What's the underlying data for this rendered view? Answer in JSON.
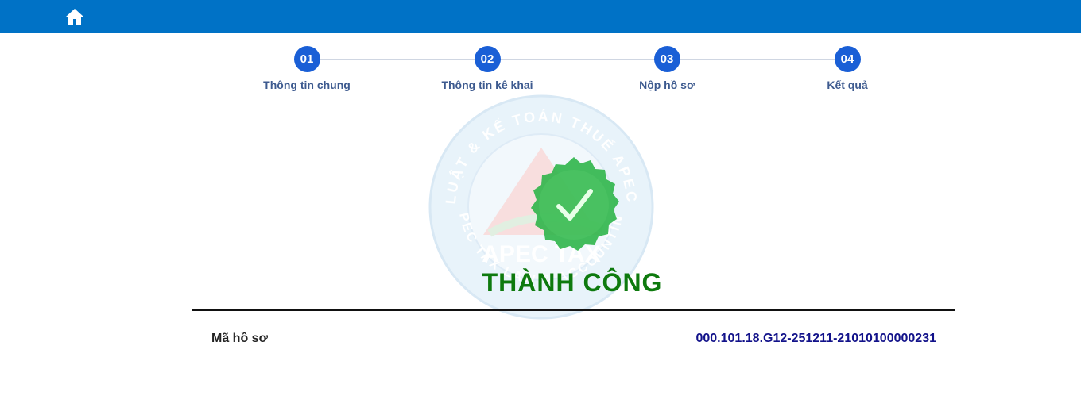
{
  "header": {
    "home_icon": "home-icon",
    "bg_color": "#0072c6"
  },
  "steps": [
    {
      "number": "01",
      "label": "Thông tin chung"
    },
    {
      "number": "02",
      "label": "Thông tin kê khai"
    },
    {
      "number": "03",
      "label": "Nộp hồ sơ"
    },
    {
      "number": "04",
      "label": "Kết quả"
    }
  ],
  "result": {
    "status_icon": "success-check-badge-icon",
    "title": "THÀNH CÔNG",
    "title_color": "#0e7a0e"
  },
  "watermark": {
    "top_text": "LUẬT & KẾ TOÁN THUẾ APEC",
    "center_text": "APEC TAX",
    "bottom_text": "APEC TAX LAW & ACCOUNTING"
  },
  "record": {
    "label": "Mã hồ sơ",
    "value": "000.101.18.G12-251211-21010100000231"
  }
}
